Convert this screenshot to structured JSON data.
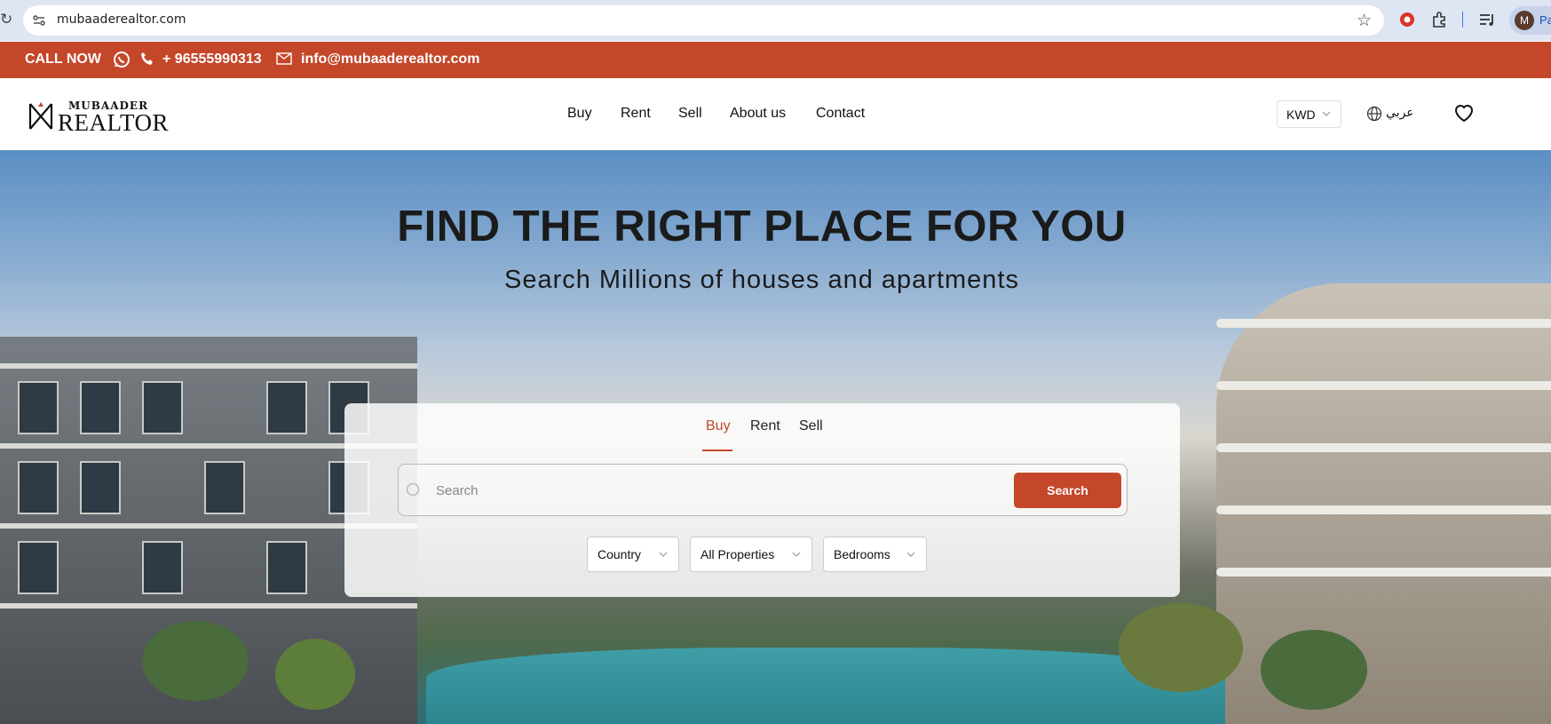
{
  "browser": {
    "url": "mubaaderealtor.com",
    "profile_initial": "M",
    "profile_label": "Pa"
  },
  "contact_bar": {
    "call_label": "CALL NOW",
    "phone": "+ 96555990313",
    "email": "info@mubaaderealtor.com",
    "bg_color": "#c4472a"
  },
  "header": {
    "logo_top": "MUBAADER",
    "logo_bottom": "REALTOR",
    "nav": [
      "Buy",
      "Rent",
      "Sell",
      "About us",
      "Contact"
    ],
    "currency": "KWD",
    "language": "عربي"
  },
  "hero": {
    "title": "FIND THE RIGHT PLACE FOR YOU",
    "subtitle": "Search Millions of houses and apartments"
  },
  "search_panel": {
    "tabs": [
      "Buy",
      "Rent",
      "Sell"
    ],
    "active_tab": "Buy",
    "search_placeholder": "Search",
    "search_button": "Search",
    "filters": [
      "Country",
      "All Properties",
      "Bedrooms"
    ],
    "accent_color": "#c4472a"
  }
}
